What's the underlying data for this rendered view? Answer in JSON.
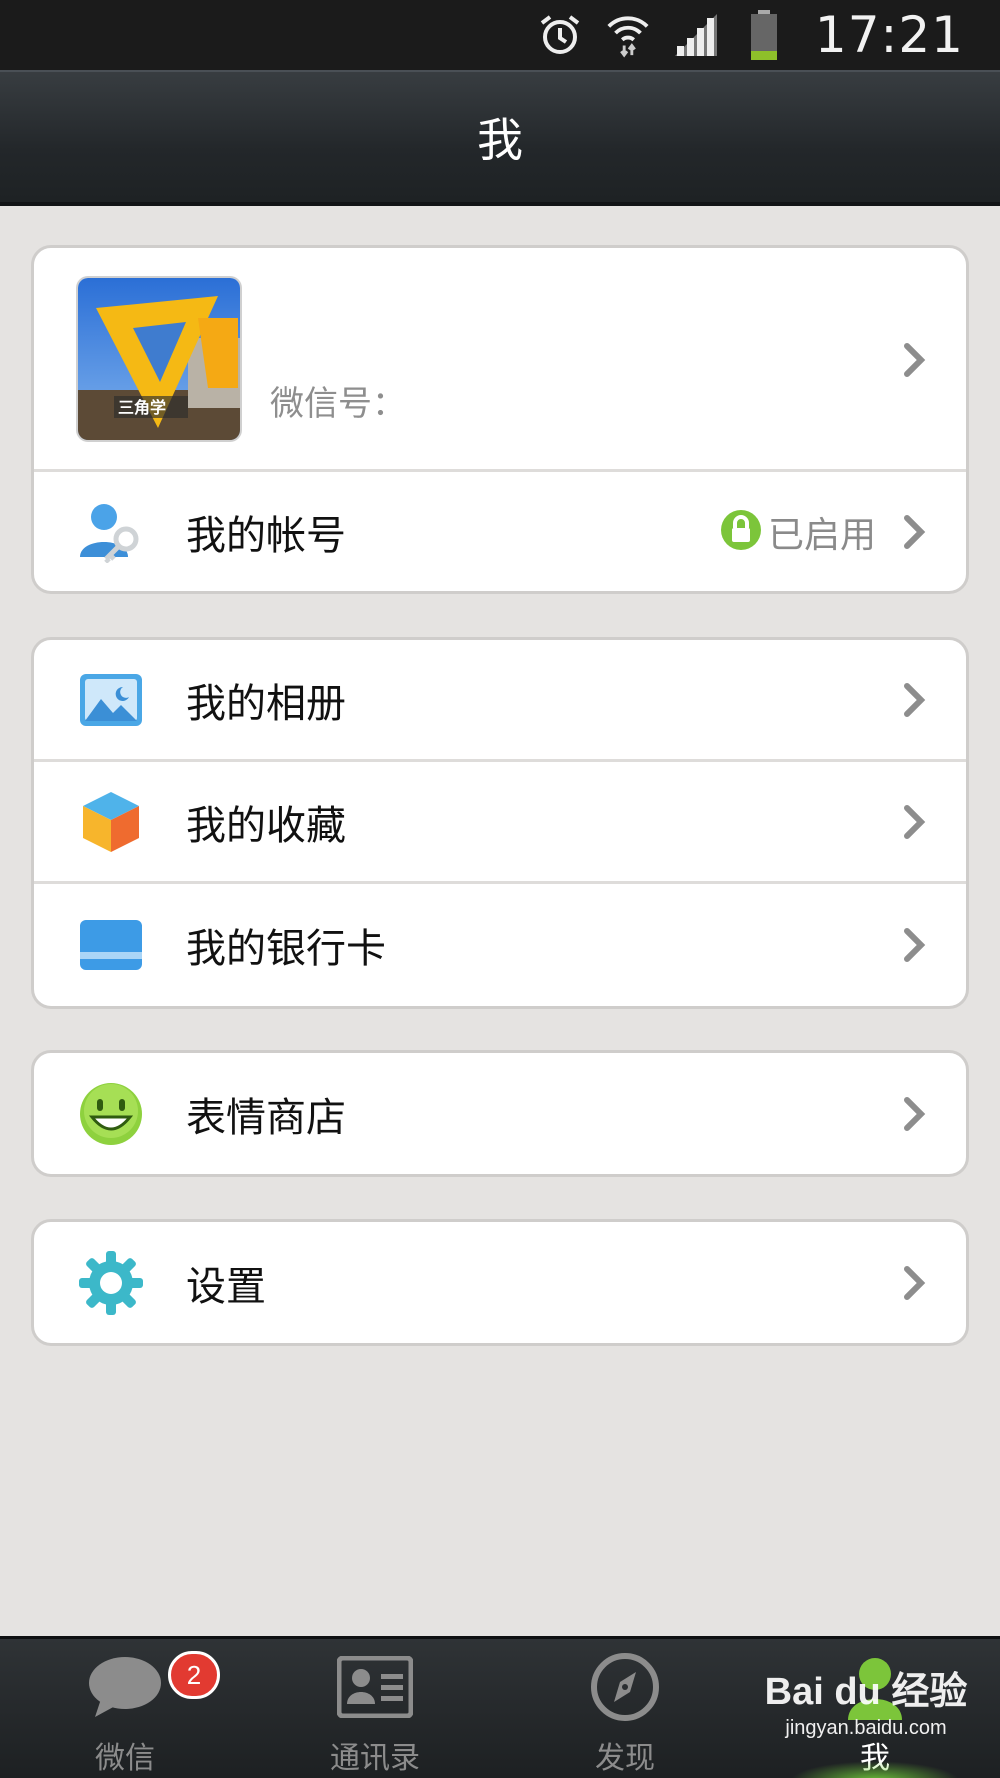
{
  "status_bar": {
    "time": "17:21",
    "icons": [
      "alarm-icon",
      "wifi-icon",
      "signal-icon",
      "battery-icon"
    ]
  },
  "header": {
    "title": "我"
  },
  "profile": {
    "name": "",
    "wechat_id_label": "微信号："
  },
  "account": {
    "label": "我的帐号",
    "status": "已启用",
    "icon": "account-key-icon",
    "status_icon": "lock-icon"
  },
  "group2": [
    {
      "label": "我的相册",
      "icon": "album-icon"
    },
    {
      "label": "我的收藏",
      "icon": "favorites-icon"
    },
    {
      "label": "我的银行卡",
      "icon": "bank-card-icon"
    }
  ],
  "sticker_store": {
    "label": "表情商店",
    "icon": "smiley-icon"
  },
  "settings": {
    "label": "设置",
    "icon": "gear-icon"
  },
  "tabs": [
    {
      "label": "微信",
      "icon": "chat-bubble-icon",
      "badge": "2"
    },
    {
      "label": "通讯录",
      "icon": "contacts-card-icon"
    },
    {
      "label": "发现",
      "icon": "compass-icon"
    },
    {
      "label": "我",
      "icon": "me-icon",
      "active": true
    }
  ],
  "watermark": {
    "logo": "Bai du 经验",
    "url": "jingyan.baidu.com"
  },
  "colors": {
    "accent_green": "#7cc53a",
    "badge_red": "#e23a31",
    "background": "#e5e3e1",
    "header_dark": "#23272a"
  }
}
